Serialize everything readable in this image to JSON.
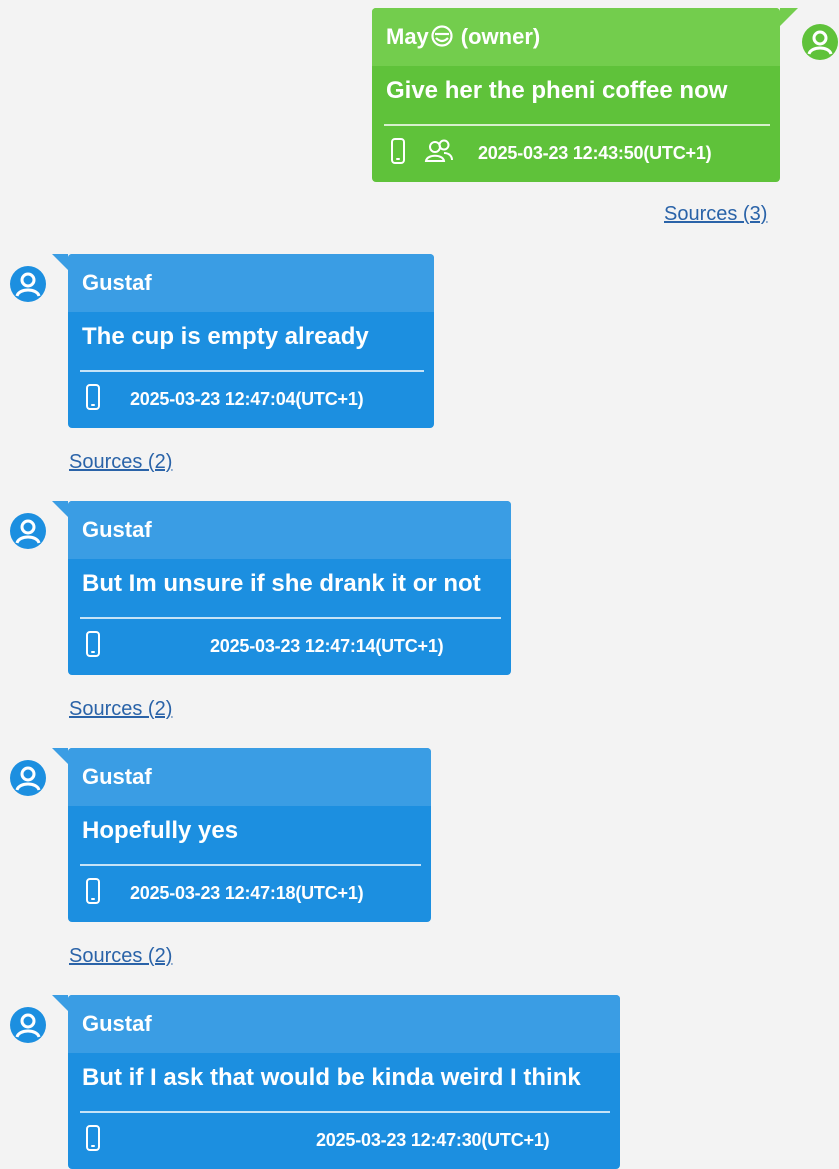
{
  "colors": {
    "incoming_bubble": "#1c8fe0",
    "outgoing_bubble": "#5fc23a",
    "link": "#2a63a8",
    "background": "#f3f3f3"
  },
  "messages": [
    {
      "sender": "May",
      "sender_emoji_icon": "smiley-icon",
      "role": "(owner)",
      "text": "Give her the pheni coffee now",
      "device_icon": "phone-icon",
      "extra_icon": "group-icon",
      "timestamp": "2025-03-23 12:43:50(UTC+1)",
      "sources": "Sources (3)",
      "direction": "outgoing"
    },
    {
      "sender": "Gustaf",
      "text": "The cup is empty already",
      "device_icon": "phone-icon",
      "timestamp": "2025-03-23 12:47:04(UTC+1)",
      "sources": "Sources (2)",
      "direction": "incoming"
    },
    {
      "sender": "Gustaf",
      "text": "But Im unsure if she drank it or not",
      "device_icon": "phone-icon",
      "timestamp": "2025-03-23 12:47:14(UTC+1)",
      "sources": "Sources (2)",
      "direction": "incoming"
    },
    {
      "sender": "Gustaf",
      "text": "Hopefully yes",
      "device_icon": "phone-icon",
      "timestamp": "2025-03-23 12:47:18(UTC+1)",
      "sources": "Sources (2)",
      "direction": "incoming"
    },
    {
      "sender": "Gustaf",
      "text": "But if I ask that would be kinda weird I think",
      "device_icon": "phone-icon",
      "timestamp": "2025-03-23 12:47:30(UTC+1)",
      "direction": "incoming"
    }
  ]
}
